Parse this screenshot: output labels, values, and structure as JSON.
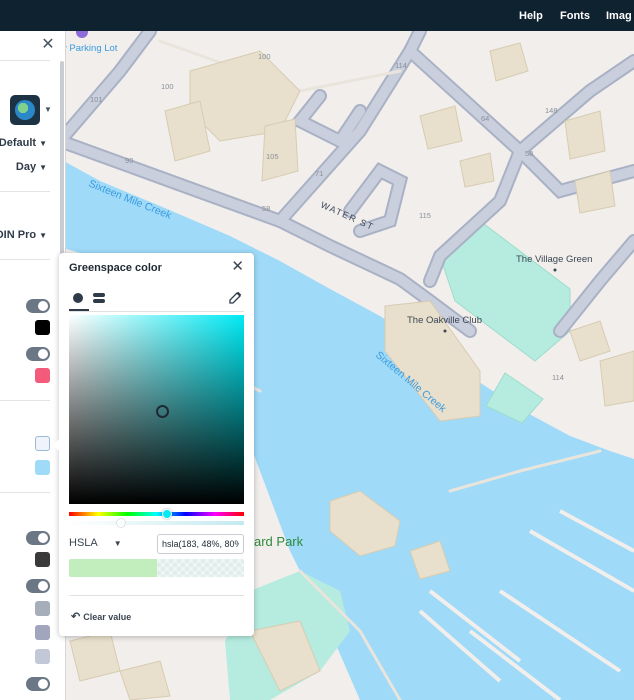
{
  "topbar": {
    "nav": [
      "Help",
      "Fonts",
      "Imag"
    ]
  },
  "map": {
    "labels": {
      "parking": "y Parking Lot",
      "creek1": "Sixteen Mile Creek",
      "creek2": "Sixteen Mile Creek",
      "water_st": "WATER ST",
      "village_green": "The Village Green",
      "oakville_club": "The Oakville Club",
      "park": "ard Park"
    },
    "house_numbers": [
      "100",
      "100",
      "101",
      "114",
      "64",
      "148",
      "58",
      "105",
      "90",
      "71",
      "58",
      "115",
      "114"
    ],
    "colors": {
      "background": "#f1eeec",
      "water": "#9fdaf8",
      "water_label": "#3a9be0",
      "road": "#bfc6d6",
      "road_casing": "#a9b1c4",
      "building": "#e8e0cc",
      "building_edge": "#d7ccb2",
      "greenspace": "#b5ecdf",
      "park_label": "#2f8a3c"
    }
  },
  "left_panel": {
    "close_icon": "close-icon",
    "style_options": [
      "Default",
      "Day",
      "DIN Pro"
    ],
    "colors": {
      "swatch_black": "#000000",
      "swatch_pink": "#f45b7a",
      "swatch_light_blue_outline": "#dce9f8",
      "swatch_sky": "#9fdaf8",
      "swatch_dark": "#3a3a3a",
      "swatch_grey1": "#a6adbb",
      "swatch_grey2": "#a2a6bd",
      "swatch_grey3": "#c3c8d8"
    }
  },
  "color_picker": {
    "title": "Greenspace color",
    "format": "HSLA",
    "value": "hsla(183, 48%, 80%, 0",
    "clear_label": "Clear value",
    "preview_color": "#c2edbd",
    "hue_color": "#00eaf4",
    "opacity_fraction": 0.5
  }
}
